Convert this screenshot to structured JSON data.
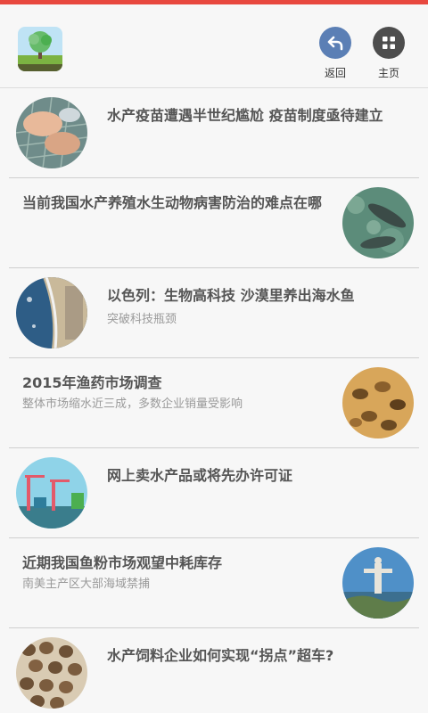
{
  "header": {
    "back_label": "返回",
    "home_label": "主页",
    "back_icon": "back-arrow-icon",
    "home_icon": "grid-icon",
    "accent": "#e8483f"
  },
  "articles": [
    {
      "title": "水产疫苗遭遇半世纪尴尬 疫苗制度亟待建立",
      "subtitle": "",
      "thumb": "net-hands"
    },
    {
      "title": "当前我国水产养殖水生动物病害防治的难点在哪",
      "subtitle": "",
      "thumb": "fish-water"
    },
    {
      "title": "以色列：生物高科技 沙漠里养出海水鱼",
      "subtitle": "突破科技瓶颈",
      "thumb": "coast-aerial"
    },
    {
      "title": "2015年渔药市场调查",
      "subtitle": "整体市场缩水近三成，多数企业销量受影响",
      "thumb": "capsules"
    },
    {
      "title": "网上卖水产品或将先办许可证",
      "subtitle": "",
      "thumb": "harbor-cranes"
    },
    {
      "title": "近期我国鱼粉市场观望中耗库存",
      "subtitle": "南美主产区大部海域禁捕",
      "thumb": "christ-statue"
    },
    {
      "title": "水产饲料企业如何实现“拐点”超车?",
      "subtitle": "",
      "thumb": "feed-pellets"
    }
  ]
}
